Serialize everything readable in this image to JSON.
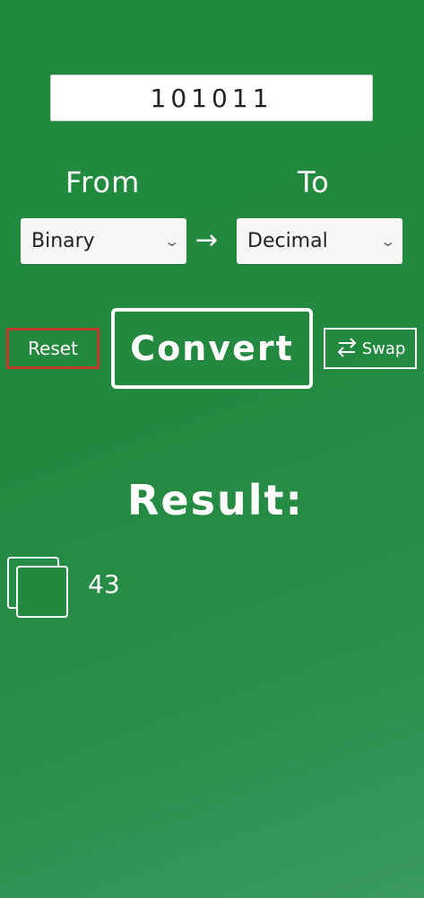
{
  "input": {
    "value": "101011",
    "placeholder": ""
  },
  "labels": {
    "from": "From",
    "to": "To"
  },
  "selects": {
    "from_value": "Binary",
    "to_value": "Decimal"
  },
  "arrow_glyph": "→",
  "buttons": {
    "reset": "Reset",
    "convert": "Convert",
    "swap": "Swap"
  },
  "result": {
    "title": "Result:",
    "value": "43"
  },
  "icons": {
    "swap": "swap-arrows-icon",
    "copy": "copy-icon",
    "dropdown": "chevron-down-icon"
  },
  "colors": {
    "background": "#23893f",
    "reset_border": "#c0392b",
    "text": "#ffffff"
  }
}
